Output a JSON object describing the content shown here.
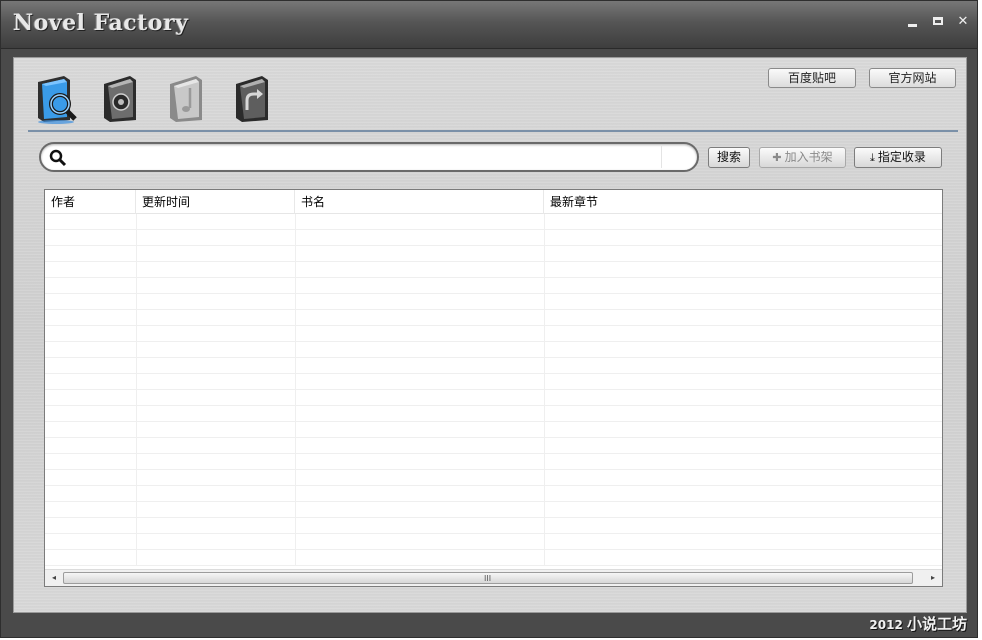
{
  "window": {
    "title": "Novel Factory",
    "controls": {
      "minimize": "–",
      "maximize": "□",
      "close": "✕"
    }
  },
  "toolbar": {
    "icons": [
      {
        "name": "search-book-icon",
        "active": true
      },
      {
        "name": "settings-book-icon",
        "active": false
      },
      {
        "name": "music-book-icon",
        "active": false,
        "disabled": true
      },
      {
        "name": "export-book-icon",
        "active": false
      }
    ],
    "baidu_tieba": "百度贴吧",
    "official_site": "官方网站"
  },
  "search": {
    "value": "",
    "placeholder": "",
    "search_button": "搜索",
    "add_shelf_button": "加入书架",
    "add_shelf_icon": "✚",
    "collect_button": "指定收录",
    "collect_icon": "⤓"
  },
  "table": {
    "columns": [
      "作者",
      "更新时间",
      "书名",
      "最新章节"
    ],
    "rows": []
  },
  "scrollbar": {
    "left_arrow": "◂",
    "right_arrow": "▸",
    "grip": "III"
  },
  "footer": {
    "year": "2012",
    "brand": "小说工坊"
  },
  "colors": {
    "title_bg": "#555555",
    "panel_bg": "#d4d4d4",
    "divider": "#7a90a8",
    "active_icon": "#3a8fe0"
  }
}
